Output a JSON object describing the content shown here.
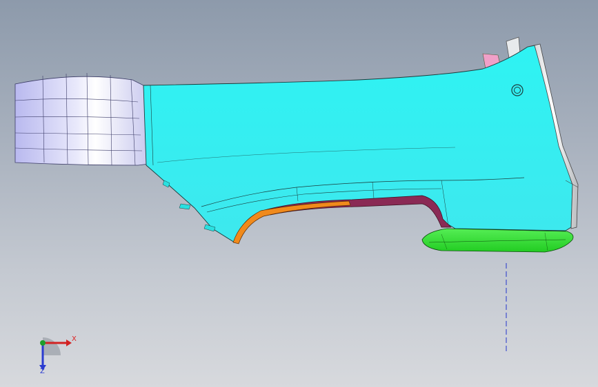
{
  "viewport": {
    "background_top": "#8d9aab",
    "background_bottom": "#d7d9dd"
  },
  "model": {
    "panel_color": "#33f0f0",
    "duct_color": "#ccccf6",
    "trim_color": "#f08a1c",
    "liner_color": "#8a2a55",
    "tray_color": "#33e033",
    "bracket_color": "#f0a0c8",
    "edge_color": "#e8eaec"
  },
  "triad": {
    "x_label": "X",
    "z_label": "Z",
    "x_color": "#d22222",
    "z_color": "#2a3bd0",
    "y_color": "#1e9e2a"
  }
}
